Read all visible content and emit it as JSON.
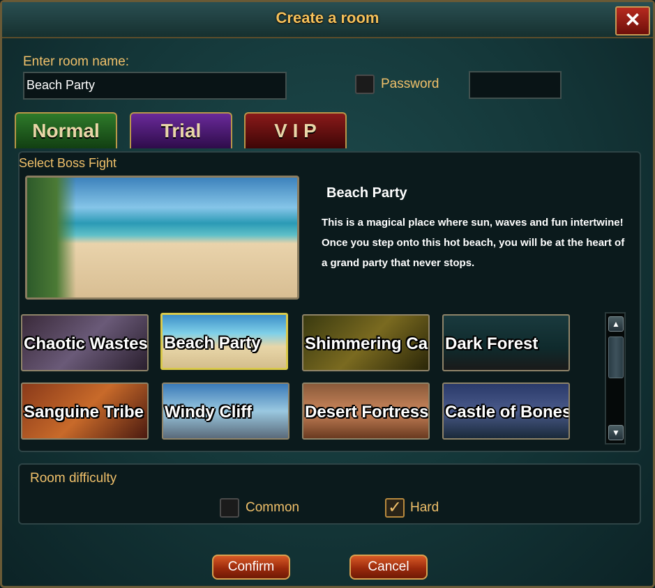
{
  "dialog": {
    "title": "Create a room",
    "close_label": "✕"
  },
  "room": {
    "name_label": "Enter room name:",
    "name_value": "Beach Party",
    "password_label": "Password",
    "password_value": ""
  },
  "tabs": [
    {
      "label": "Normal",
      "color": "#1f5a1f"
    },
    {
      "label": "Trial",
      "color": "#4a1a6e"
    },
    {
      "label": "V I P",
      "color": "#6e1010"
    }
  ],
  "boss": {
    "section_label": "Select Boss Fight",
    "selected_title": "Beach Party",
    "selected_description": "This is a magical place where sun, waves and fun intertwine! Once you step onto this hot beach, you will be at the heart of a grand party that never stops.",
    "cards": [
      {
        "label": "Chaotic Wastes",
        "bg": "linear-gradient(135deg,#3a2a3a,#6a5a78 50%,#2a1f2e)"
      },
      {
        "label": "Beach Party",
        "bg": "linear-gradient(#3d8fc8 0%,#7fd0e8 35%,#e8d6a8 60%,#d4be8e 100%)"
      },
      {
        "label": "Shimmering Ca",
        "bg": "linear-gradient(135deg,#3a3a10,#7a6a20 50%,#2a2608)"
      },
      {
        "label": "Dark Forest",
        "bg": "linear-gradient(#1a3a3e,#0f2a2c 60%,#1a1a1a)"
      },
      {
        "label": "Sanguine Tribe",
        "bg": "linear-gradient(135deg,#8a3a1a,#c86a2a 50%,#4a1a10)"
      },
      {
        "label": "Windy Cliff",
        "bg": "linear-gradient(#3a7ab8,#9ac8e0 50%,#5a6a7a)"
      },
      {
        "label": "Desert Fortress",
        "bg": "linear-gradient(#8a5a3a,#c8845a 50%,#6a3a20)"
      },
      {
        "label": "Castle of Bones",
        "bg": "linear-gradient(#2a3a6a,#4a5a8a 50%,#1a2a3a)"
      }
    ],
    "selected_index": 1
  },
  "difficulty": {
    "section_label": "Room difficulty",
    "common_label": "Common",
    "common_checked": false,
    "hard_label": "Hard",
    "hard_checked": true
  },
  "buttons": {
    "confirm": "Confirm",
    "cancel": "Cancel"
  },
  "icons": {
    "check": "✓",
    "scroll_up": "▲",
    "scroll_down": "▼"
  }
}
